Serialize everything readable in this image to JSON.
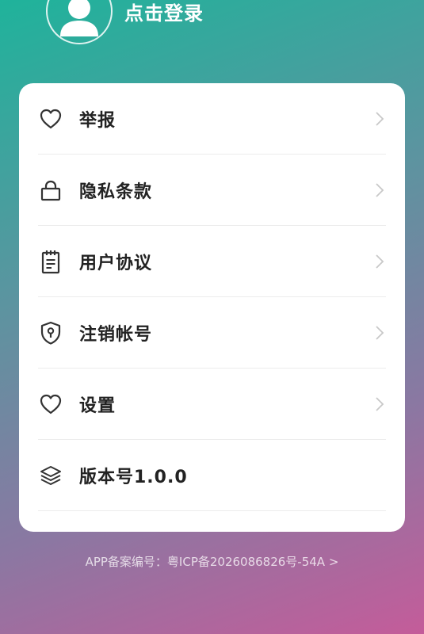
{
  "header": {
    "login_label": "点击登录",
    "avatar_icon": "user-avatar-icon"
  },
  "menu": {
    "items": [
      {
        "label": "举报",
        "icon": "heart-icon"
      },
      {
        "label": "隐私条款",
        "icon": "lock-icon"
      },
      {
        "label": "用户协议",
        "icon": "clipboard-icon"
      },
      {
        "label": "注销帐号",
        "icon": "shield-keyhole-icon"
      },
      {
        "label": "设置",
        "icon": "heart-icon"
      },
      {
        "label": "版本号1.0.0",
        "icon": "layers-icon"
      }
    ]
  },
  "footer": {
    "icp_text": "APP备案编号：粤ICP备2026086826号-54A >"
  },
  "colors": {
    "gradient_start": "#1fb39b",
    "gradient_end": "#c45c9a",
    "card_bg": "#ffffff",
    "label_color": "#222222"
  }
}
